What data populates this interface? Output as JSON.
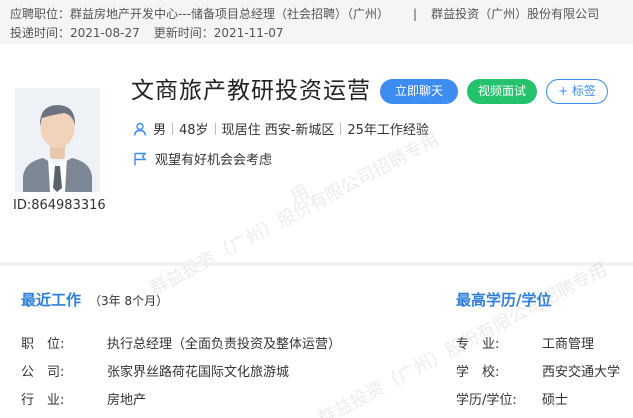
{
  "top": {
    "position_label": "应聘职位：",
    "position_value": "群益房地产开发中心---储备项目总经理（社会招聘）（广州）",
    "separator": "|",
    "company": "群益投资（广州）股份有限公司",
    "apply_label": "投递时间：",
    "apply_date": "2021-08-27",
    "update_label": "更新时间：",
    "update_date": "2021-11-07"
  },
  "candidate": {
    "name": "文商旅产教研投资运营",
    "id_text": "ID:864983316",
    "gender": "男",
    "age": "48岁",
    "residence": "现居住 西安-新城区",
    "experience": "25年工作经验",
    "intent": "观望有好机会会考虑"
  },
  "buttons": {
    "chat": "立即聊天",
    "video": "视频面试",
    "tag": "+ 标签"
  },
  "recent_work": {
    "title": "最近工作",
    "duration": "（3年 8个月）",
    "rows": [
      {
        "label": "职　位:",
        "value": "执行总经理（全面负责投资及整体运营）"
      },
      {
        "label": "公　司:",
        "value": "张家界丝路荷花国际文化旅游城"
      },
      {
        "label": "行　业:",
        "value": "房地产"
      }
    ]
  },
  "education": {
    "title": "最高学历/学位",
    "rows": [
      {
        "label": "专　业:",
        "value": "工商管理"
      },
      {
        "label": "学　校:",
        "value": "西安交通大学"
      },
      {
        "label": "学历/学位:",
        "value": "硕士"
      }
    ]
  },
  "watermark": {
    "line1": "群益投资（广州）股份有限公司招聘专用",
    "line2": "用"
  },
  "colors": {
    "accent": "#2f7fd8",
    "chat_button": "#3d8cf0",
    "video_button": "#25c26e"
  }
}
